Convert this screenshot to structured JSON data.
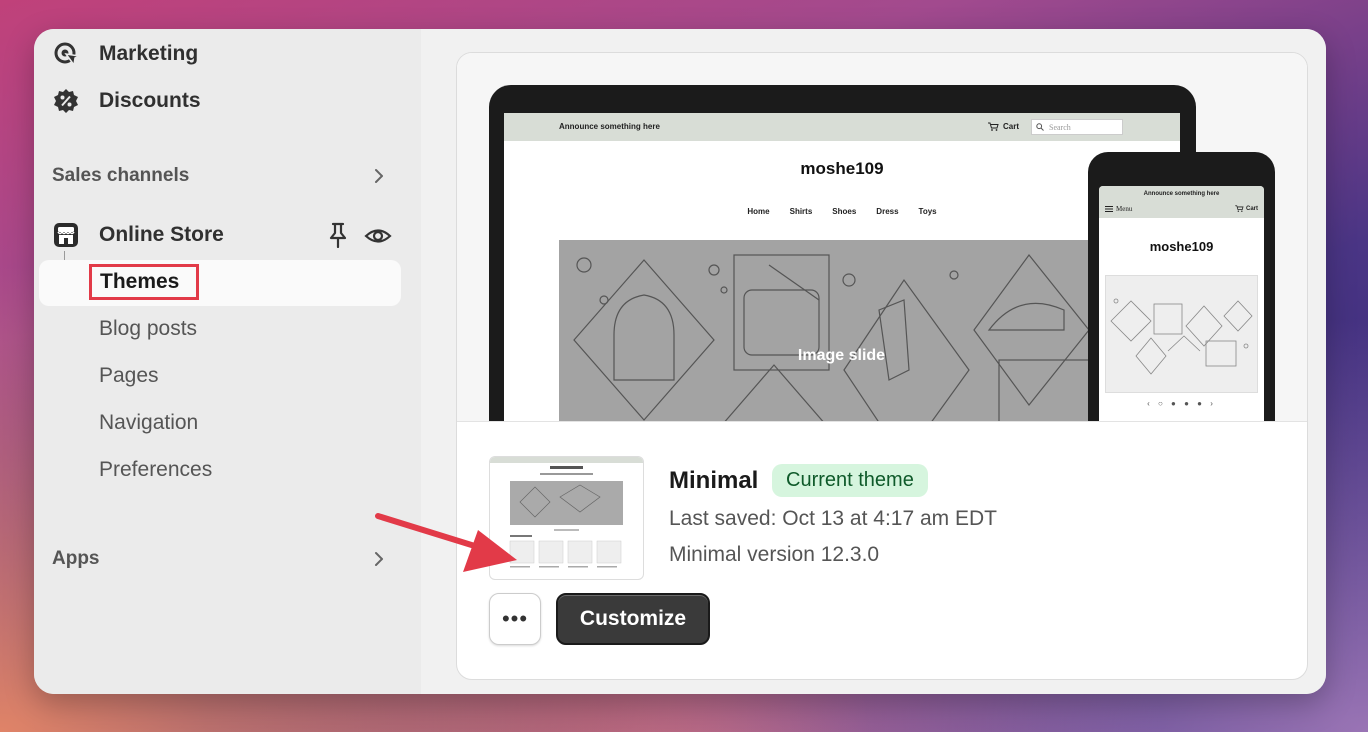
{
  "sidebar": {
    "marketing_label": "Marketing",
    "discounts_label": "Discounts",
    "sales_channels_label": "Sales channels",
    "online_store_label": "Online Store",
    "sub_items": {
      "themes": "Themes",
      "blog_posts": "Blog posts",
      "pages": "Pages",
      "navigation": "Navigation",
      "preferences": "Preferences"
    },
    "apps_label": "Apps"
  },
  "preview": {
    "announcement": "Announce something here",
    "cart_label": "Cart",
    "search_placeholder": "Search",
    "store_title": "moshe109",
    "nav": [
      "Home",
      "Shirts",
      "Shoes",
      "Dress",
      "Toys"
    ],
    "slide_caption": "Image slide",
    "phone_menu_label": "Menu",
    "phone_dots": "‹ ○ ● ● ● ›"
  },
  "theme": {
    "name": "Minimal",
    "badge": "Current theme",
    "last_saved": "Last saved: Oct 13 at 4:17 am EDT",
    "version": "Minimal version 12.3.0"
  },
  "actions": {
    "more_label": "•••",
    "customize_label": "Customize"
  },
  "colors": {
    "annotation_red": "#e23a48",
    "badge_bg": "#d6f5de",
    "badge_text": "#0f5a2a",
    "customize_bg": "#3a3a3a"
  },
  "icons": {
    "marketing": "marketing-target-icon",
    "discounts": "discount-badge-icon",
    "online_store": "storefront-icon",
    "pin": "pin-icon",
    "view": "eye-icon",
    "chevron": "chevron-right-icon"
  }
}
